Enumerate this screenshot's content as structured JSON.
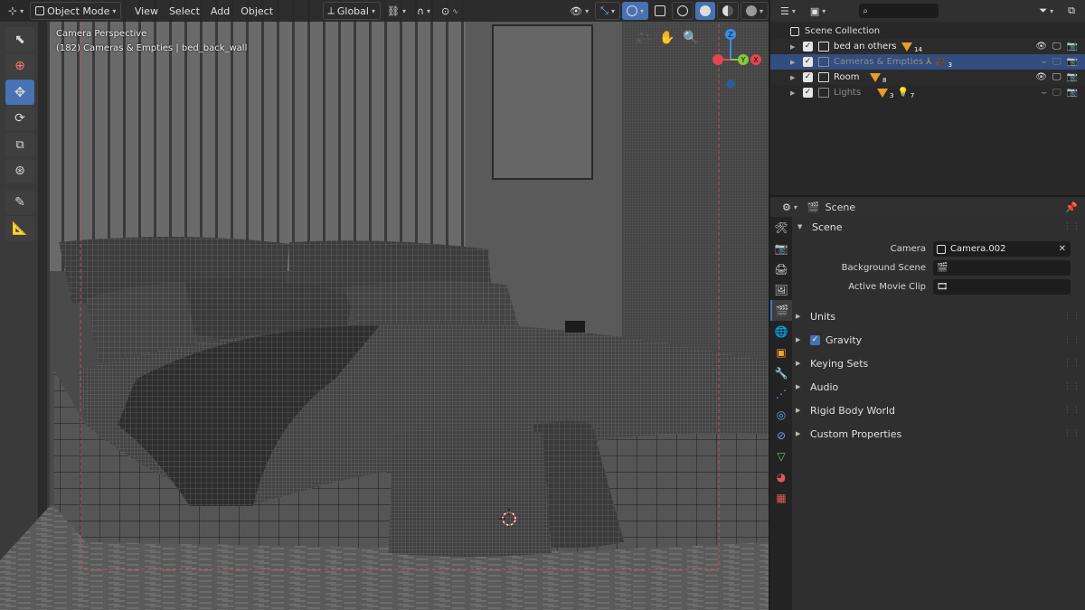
{
  "viewport": {
    "header": {
      "mode": "Object Mode",
      "menus": [
        "View",
        "Select",
        "Add",
        "Object"
      ],
      "orientation": "Global"
    },
    "info": {
      "line1": "Camera Perspective",
      "line2": "(182) Cameras & Empties | bed_back_wall"
    },
    "gizmo": {
      "z": "Z",
      "y": "Y",
      "x": "X"
    },
    "tools": [
      "cursor-select",
      "cursor-3d",
      "move",
      "rotate",
      "scale",
      "transform",
      "annotate",
      "measure"
    ],
    "active_tool": "move"
  },
  "outliner": {
    "root": "Scene Collection",
    "rows": [
      {
        "name": "bed an others",
        "badge_count": "14",
        "selected": false,
        "dim": false
      },
      {
        "name": "Cameras & Empties",
        "badge_count": "3",
        "selected": true,
        "dim": true
      },
      {
        "name": "Room",
        "badge_count": "8",
        "selected": false,
        "dim": false
      },
      {
        "name": "Lights",
        "badge_count": "3",
        "badge_count2": "7",
        "selected": false,
        "dim": true
      }
    ]
  },
  "properties": {
    "context": "Scene",
    "section": "Scene",
    "fields": [
      {
        "label": "Camera",
        "value": "Camera.002"
      },
      {
        "label": "Background Scene",
        "value": ""
      },
      {
        "label": "Active Movie Clip",
        "value": ""
      }
    ],
    "panels": [
      {
        "label": "Units",
        "checkbox": false
      },
      {
        "label": "Gravity",
        "checkbox": true
      },
      {
        "label": "Keying Sets",
        "checkbox": false
      },
      {
        "label": "Audio",
        "checkbox": false
      },
      {
        "label": "Rigid Body World",
        "checkbox": false
      },
      {
        "label": "Custom Properties",
        "checkbox": false
      }
    ]
  },
  "colors": {
    "accent": "#4772b3",
    "axis_x": "#e4464f",
    "axis_y": "#85c83b",
    "axis_z": "#3a8ee6",
    "collection_badge": "#e89c2c"
  }
}
